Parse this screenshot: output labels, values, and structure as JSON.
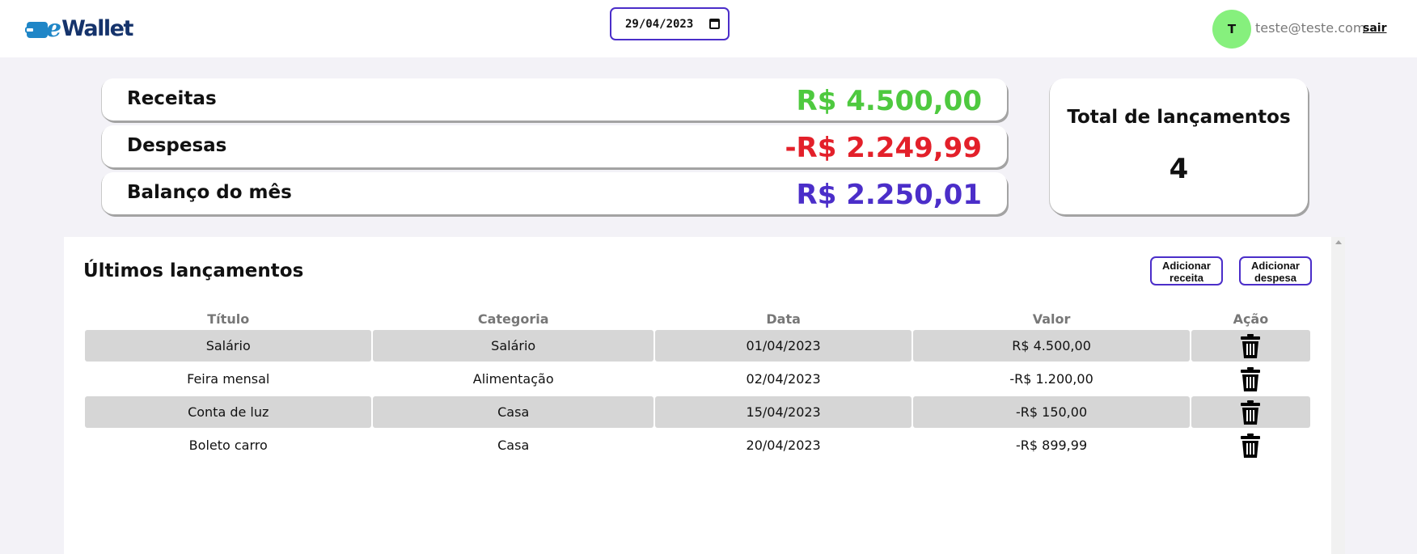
{
  "header": {
    "logo_text": "eWallet",
    "date_value": "29/04/2023",
    "avatar_initial": "T",
    "user_email": "teste@teste.com",
    "logout_label": "sair"
  },
  "summary": {
    "income_label": "Receitas",
    "income_value": "R$ 4.500,00",
    "expense_label": "Despesas",
    "expense_value": "-R$ 2.249,99",
    "balance_label": "Balanço do mês",
    "balance_value": "R$ 2.250,01",
    "total_title": "Total de lançamentos",
    "total_count": "4"
  },
  "colors": {
    "income": "#4ec93f",
    "expense": "#e3202a",
    "balance": "#4b2ec9",
    "accent": "#4b2ec9",
    "avatar": "#86f07d",
    "brand": "#1f86c7"
  },
  "transactions": {
    "title": "Últimos lançamentos",
    "add_income_label": "Adicionar receita",
    "add_expense_label": "Adicionar despesa",
    "columns": [
      "Título",
      "Categoria",
      "Data",
      "Valor",
      "Ação"
    ],
    "rows": [
      {
        "title": "Salário",
        "category": "Salário",
        "date": "01/04/2023",
        "value": "R$ 4.500,00"
      },
      {
        "title": "Feira mensal",
        "category": "Alimentação",
        "date": "02/04/2023",
        "value": "-R$ 1.200,00"
      },
      {
        "title": "Conta de luz",
        "category": "Casa",
        "date": "15/04/2023",
        "value": "-R$ 150,00"
      },
      {
        "title": "Boleto carro",
        "category": "Casa",
        "date": "20/04/2023",
        "value": "-R$ 899,99"
      }
    ]
  }
}
